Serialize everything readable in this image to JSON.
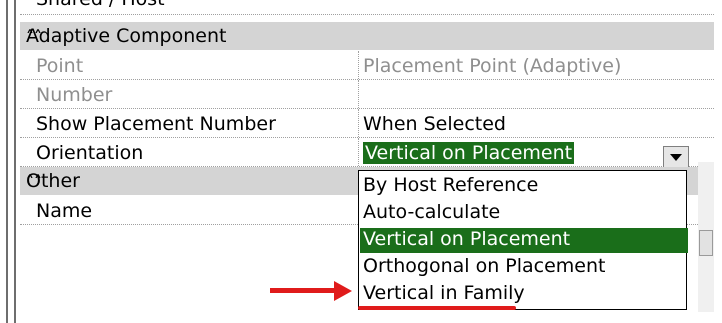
{
  "truncated_top_text": "Shared / Host",
  "categories": {
    "adaptive": "Adaptive Component",
    "other": "Other"
  },
  "rows": [
    {
      "key": "Point",
      "value": "Placement Point (Adaptive)"
    },
    {
      "key": "Number",
      "value": ""
    },
    {
      "key": "Show Placement Number",
      "value": "When Selected"
    },
    {
      "key": "Orientation",
      "value": "Vertical on Placement"
    },
    {
      "key": "Name",
      "value": ""
    }
  ],
  "dropdown": {
    "options": [
      "By Host Reference",
      "Auto-calculate",
      "Vertical on Placement",
      "Orthogonal on Placement",
      "Vertical in Family"
    ],
    "highlighted_index": 2
  },
  "colors": {
    "selection": "#1a6e1a",
    "annotation": "#e01b1b",
    "category_bg": "#d4d4d4"
  },
  "icons": {
    "collapse": "double-chevron-up-icon",
    "dropdown": "triangle-down-icon"
  }
}
